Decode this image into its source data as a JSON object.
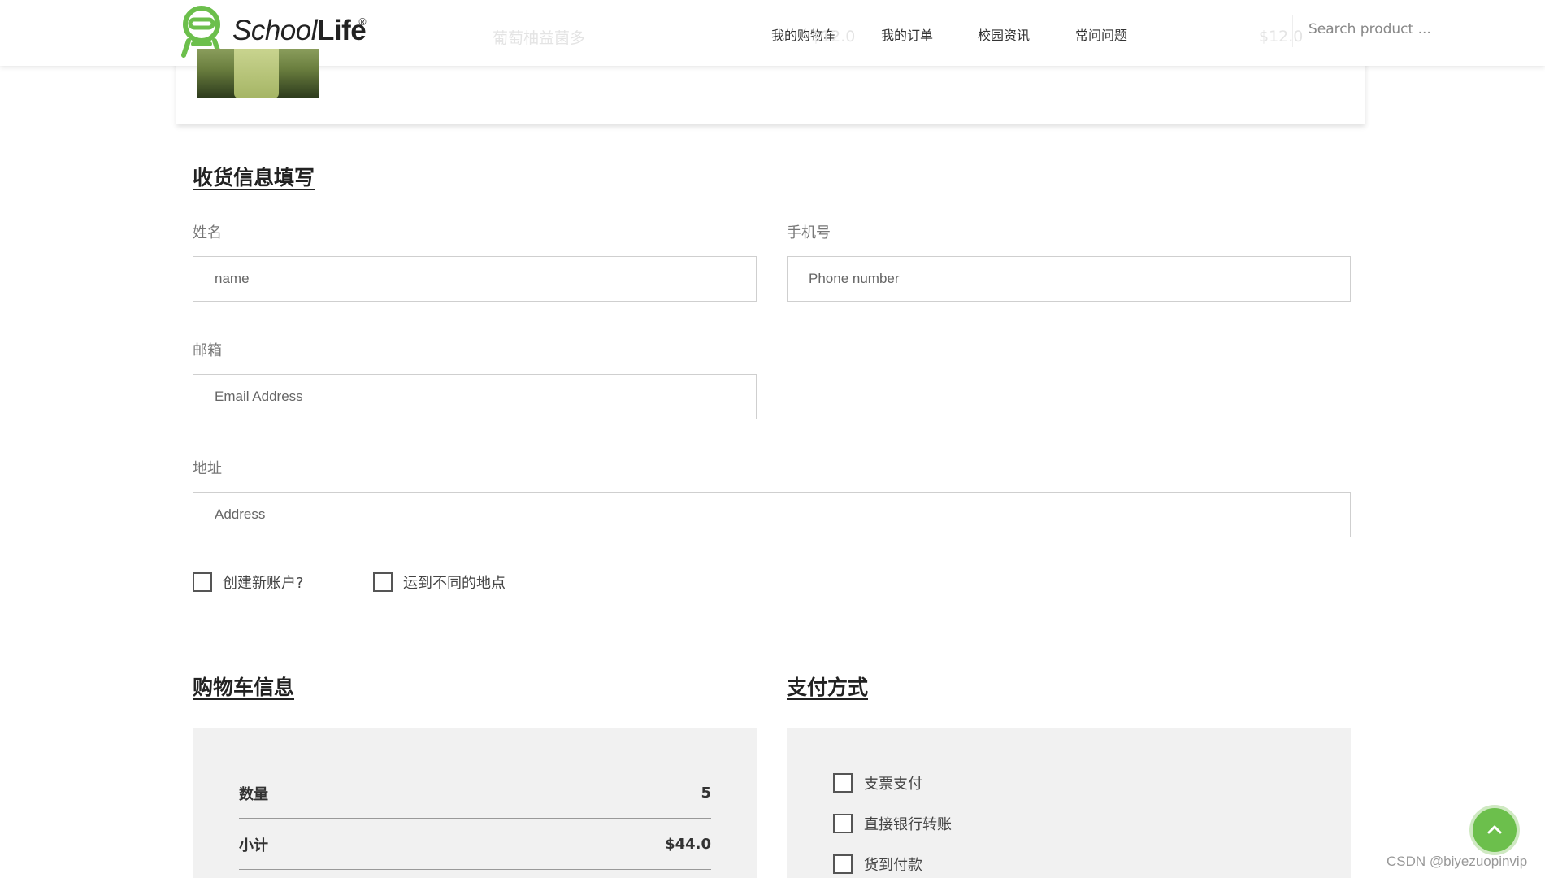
{
  "header": {
    "logo": {
      "text_a": "School",
      "text_b": "Life",
      "reg": "®"
    },
    "nav": [
      "我的购物车",
      "我的订单",
      "校园资讯",
      "常问问题"
    ],
    "search_placeholder": "Search product ..."
  },
  "cart_preview": {
    "product_name": "葡萄柚益菌多",
    "price_a": "$12.0",
    "price_b": "$12.0"
  },
  "shipping": {
    "title": "收货信息填写",
    "name_label": "姓名",
    "name_placeholder": "name",
    "phone_label": "手机号",
    "phone_placeholder": "Phone number",
    "email_label": "邮箱",
    "email_placeholder": "Email Address",
    "address_label": "地址",
    "address_placeholder": "Address",
    "create_account": "创建新账户?",
    "ship_different": "运到不同的地点"
  },
  "cart_info": {
    "title": "购物车信息",
    "rows": [
      {
        "label": "数量",
        "value": "5"
      },
      {
        "label": "小计",
        "value": "$44.0"
      }
    ]
  },
  "payment": {
    "title": "支付方式",
    "options": [
      "支票支付",
      "直接银行转账",
      "货到付款"
    ]
  },
  "watermark": "CSDN @biyezuopinvip",
  "colors": {
    "accent_green": "#6cbf4c",
    "panel_bg": "#f1f1f1"
  }
}
